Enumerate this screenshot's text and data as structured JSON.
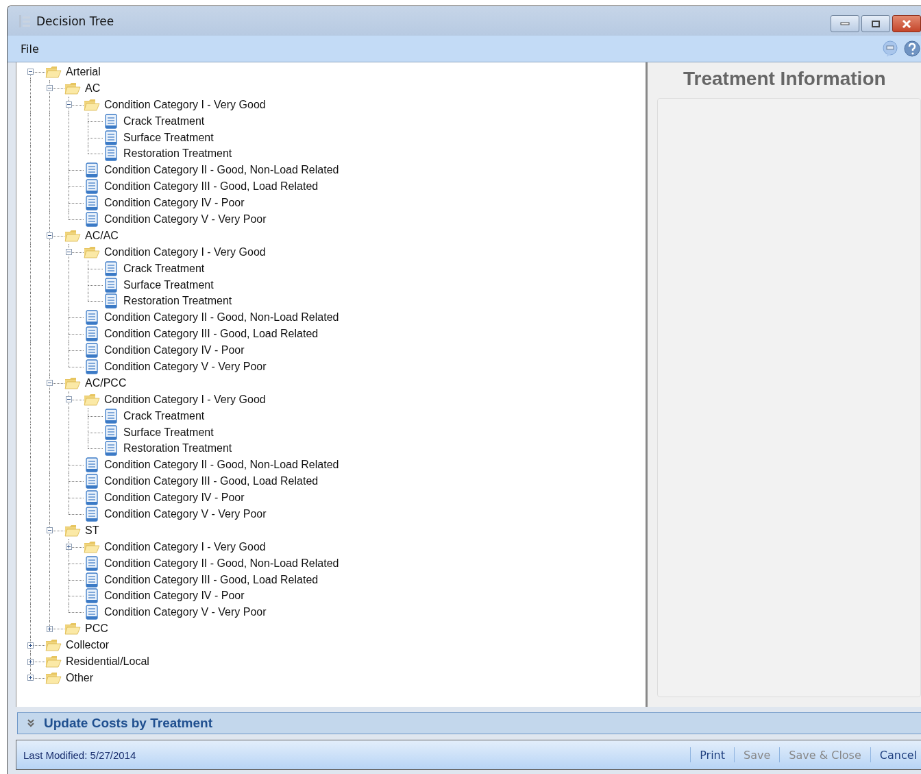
{
  "window": {
    "title": "Decision Tree"
  },
  "menu": [
    "File"
  ],
  "tree": [
    {
      "label": "Arterial",
      "kind": "folder",
      "expanded": true,
      "children": [
        {
          "label": "AC",
          "kind": "folder",
          "expanded": true,
          "children": [
            {
              "label": "Condition Category I - Very Good",
              "kind": "folder",
              "expanded": true,
              "children": [
                {
                  "label": "Crack Treatment",
                  "kind": "doc"
                },
                {
                  "label": "Surface Treatment",
                  "kind": "doc"
                },
                {
                  "label": "Restoration Treatment",
                  "kind": "doc"
                }
              ]
            },
            {
              "label": "Condition Category II - Good, Non-Load Related",
              "kind": "doc"
            },
            {
              "label": "Condition Category III - Good, Load Related",
              "kind": "doc"
            },
            {
              "label": "Condition Category IV - Poor",
              "kind": "doc"
            },
            {
              "label": "Condition Category V - Very Poor",
              "kind": "doc"
            }
          ]
        },
        {
          "label": "AC/AC",
          "kind": "folder",
          "expanded": true,
          "children": [
            {
              "label": "Condition Category I - Very Good",
              "kind": "folder",
              "expanded": true,
              "children": [
                {
                  "label": "Crack Treatment",
                  "kind": "doc"
                },
                {
                  "label": "Surface Treatment",
                  "kind": "doc"
                },
                {
                  "label": "Restoration Treatment",
                  "kind": "doc"
                }
              ]
            },
            {
              "label": "Condition Category II - Good, Non-Load Related",
              "kind": "doc"
            },
            {
              "label": "Condition Category III - Good, Load Related",
              "kind": "doc"
            },
            {
              "label": "Condition Category IV - Poor",
              "kind": "doc"
            },
            {
              "label": "Condition Category V - Very Poor",
              "kind": "doc"
            }
          ]
        },
        {
          "label": "AC/PCC",
          "kind": "folder",
          "expanded": true,
          "children": [
            {
              "label": "Condition Category I - Very Good",
              "kind": "folder",
              "expanded": true,
              "children": [
                {
                  "label": "Crack Treatment",
                  "kind": "doc"
                },
                {
                  "label": "Surface Treatment",
                  "kind": "doc"
                },
                {
                  "label": "Restoration Treatment",
                  "kind": "doc"
                }
              ]
            },
            {
              "label": "Condition Category II - Good, Non-Load Related",
              "kind": "doc"
            },
            {
              "label": "Condition Category III - Good, Load Related",
              "kind": "doc"
            },
            {
              "label": "Condition Category IV - Poor",
              "kind": "doc"
            },
            {
              "label": "Condition Category V - Very Poor",
              "kind": "doc"
            }
          ]
        },
        {
          "label": "ST",
          "kind": "folder",
          "expanded": true,
          "children": [
            {
              "label": "Condition Category I - Very Good",
              "kind": "folder",
              "expanded": false
            },
            {
              "label": "Condition Category II - Good, Non-Load Related",
              "kind": "doc"
            },
            {
              "label": "Condition Category III - Good, Load Related",
              "kind": "doc"
            },
            {
              "label": "Condition Category IV - Poor",
              "kind": "doc"
            },
            {
              "label": "Condition Category V - Very Poor",
              "kind": "doc"
            }
          ]
        },
        {
          "label": "PCC",
          "kind": "folder",
          "expanded": false
        }
      ]
    },
    {
      "label": "Collector",
      "kind": "folder",
      "expanded": false
    },
    {
      "label": "Residential/Local",
      "kind": "folder",
      "expanded": false
    },
    {
      "label": "Other",
      "kind": "folder",
      "expanded": false
    }
  ],
  "details": {
    "title": "Treatment Information"
  },
  "expander": {
    "label": "Update Costs by Treatment",
    "expanded": false
  },
  "status_bar": {
    "text": "Last Modified: 5/27/2014",
    "buttons": [
      {
        "label": "Print",
        "disabled": false
      },
      {
        "label": "Save",
        "disabled": true
      },
      {
        "label": "Save & Close",
        "disabled": true
      },
      {
        "label": "Cancel",
        "disabled": false
      }
    ]
  }
}
